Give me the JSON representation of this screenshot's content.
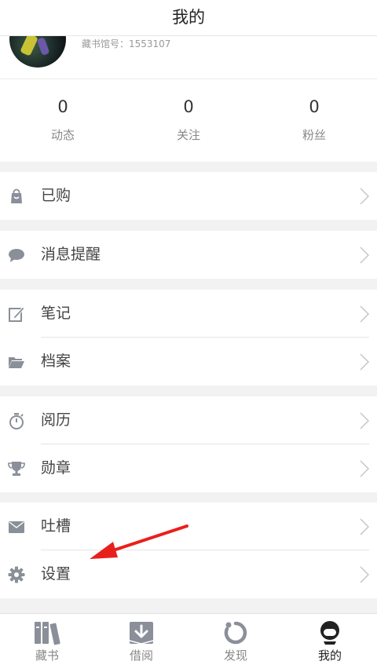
{
  "header": {
    "title": "我的"
  },
  "profile": {
    "account": "藏书馆号：1553107"
  },
  "stats": [
    {
      "num": "0",
      "label": "动态"
    },
    {
      "num": "0",
      "label": "关注"
    },
    {
      "num": "0",
      "label": "粉丝"
    }
  ],
  "menu": {
    "purchased": "已购",
    "messages": "消息提醒",
    "notes": "笔记",
    "archive": "档案",
    "history": "阅历",
    "medals": "勋章",
    "feedback": "吐槽",
    "settings": "设置"
  },
  "tabs": [
    {
      "label": "藏书",
      "icon": "bookshelf-icon"
    },
    {
      "label": "借阅",
      "icon": "download-icon"
    },
    {
      "label": "发现",
      "icon": "refresh-ring-icon"
    },
    {
      "label": "我的",
      "icon": "user-icon",
      "active": true
    }
  ],
  "colors": {
    "icon": "#8a8f99",
    "arrow": "#e8201c",
    "active": "#222222"
  }
}
